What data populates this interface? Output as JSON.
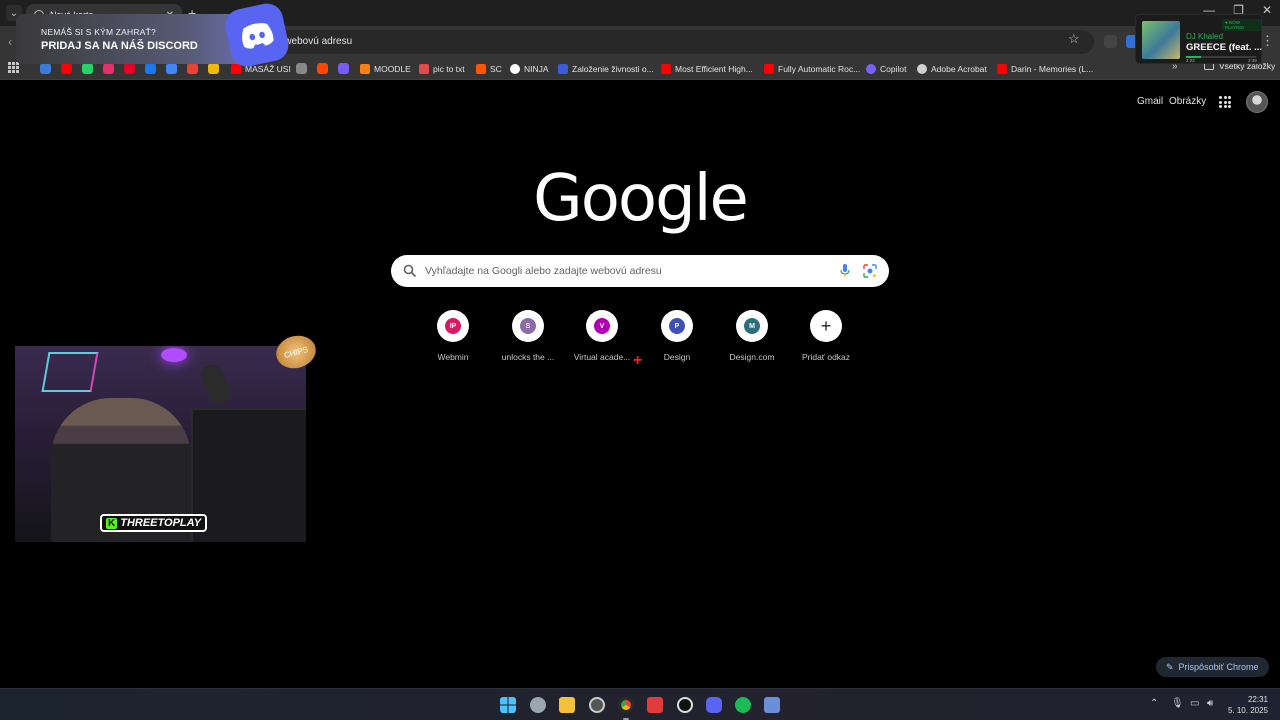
{
  "browser": {
    "tab_title": "Nová karta",
    "omnibox_text": "e webovú adresu"
  },
  "bookmarks": [
    {
      "label": "MASÁŽ USI",
      "color": "#ff0000"
    },
    {
      "label": "MOODLE",
      "color": "#f98012"
    },
    {
      "label": "pic to txt",
      "color": "#e34b4b"
    },
    {
      "label": "SC",
      "color": "#ff5500"
    },
    {
      "label": "NINJA",
      "color": "#ffffff"
    },
    {
      "label": "Založenie živnosti o...",
      "color": "#3b5bdb"
    },
    {
      "label": "Most Efficient High...",
      "color": "#ff0000"
    },
    {
      "label": "Fully Automatic Roc...",
      "color": "#ff0000"
    },
    {
      "label": "Copilot",
      "color": "#7b61ff"
    },
    {
      "label": "Adobe Acrobat",
      "color": "#d0d0d0"
    },
    {
      "label": "Darin - Memories (L...",
      "color": "#ff0000"
    }
  ],
  "bookmarks_all": "Všetky záložky",
  "discord_overlay": {
    "line1": "NEMÁŠ SI S KÝM ZAHRAŤ?",
    "line2": "PRIDAJ SA NA NÁŠ DISCORD",
    "color": "#5865f2"
  },
  "now_playing": {
    "badge": "● NOW PLAYING",
    "artist": "DJ Khaled",
    "title": "GREECE (feat. ...",
    "time_elapsed": "2:22",
    "time_total": "3:39",
    "progress": 0.22
  },
  "ntp": {
    "gmail": "Gmail",
    "images": "Obrázky",
    "logo": "Google",
    "search_placeholder": "Vyhľadajte na Googli alebo zadajte webovú adresu",
    "shortcuts": [
      {
        "label": "Webmin",
        "letter": "IP",
        "color": "#d81b60"
      },
      {
        "label": "unlocks the ...",
        "letter": "S",
        "color": "#8e6aa8"
      },
      {
        "label": "Virtual acade...",
        "letter": "V",
        "color": "#b000b5"
      },
      {
        "label": "Design",
        "letter": "P",
        "color": "#3f51b5"
      },
      {
        "label": "Design.com",
        "letter": "M",
        "color": "#2c6e7e"
      },
      {
        "label": "Pridať odkaz",
        "letter": "+",
        "color": "#202124"
      }
    ],
    "customize": "Prispôsobiť Chrome"
  },
  "webcam": {
    "channel": "THREETOPLAY",
    "kick_letter": "K",
    "chip_text": "CHIPS"
  },
  "taskbar": {
    "time": "22:31",
    "date": "5. 10. 2025"
  }
}
